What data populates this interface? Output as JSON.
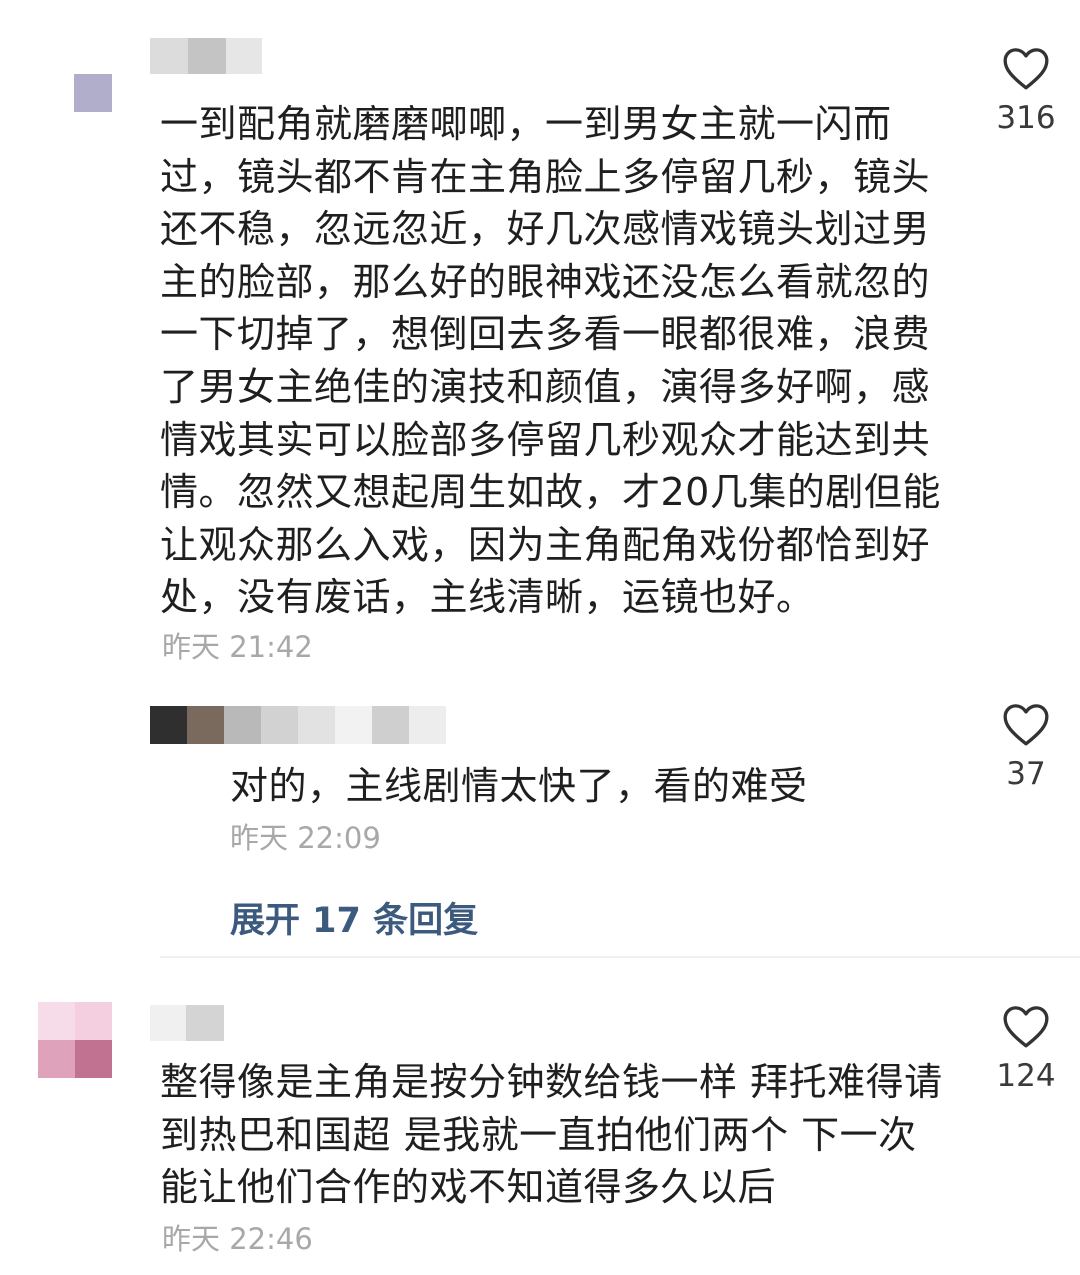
{
  "comments": [
    {
      "text": "一到配角就磨磨唧唧，一到男女主就一闪而过，镜头都不肯在主角脸上多停留几秒，镜头还不稳，忽远忽近，好几次感情戏镜头划过男主的脸部，那么好的眼神戏还没怎么看就忽的一下切掉了，想倒回去多看一眼都很难，浪费了男女主绝佳的演技和颜值，演得多好啊，感情戏其实可以脸部多停留几秒观众才能达到共情。忽然又想起周生如故，才20几集的剧但能让观众那么入戏，因为主角配角戏份都恰到好处，没有废话，主线清晰，运镜也好。",
      "time": "昨天 21:42",
      "likes": "316",
      "reply": {
        "text": "对的，主线剧情太快了，看的难受",
        "time": "昨天 22:09",
        "likes": "37"
      },
      "expand_label": "展开 17 条回复"
    },
    {
      "text": "整得像是主角是按分钟数给钱一样 拜托难得请到热巴和国超 是我就一直拍他们两个 下一次能让他们合作的戏不知道得多久以后",
      "time": "昨天 22:46",
      "likes": "124"
    }
  ],
  "colors": {
    "link": "#3b5a7e",
    "timestamp": "#a8a8a8",
    "text": "#1f1f1f"
  },
  "icons": {
    "like": "heart-outline-icon"
  }
}
